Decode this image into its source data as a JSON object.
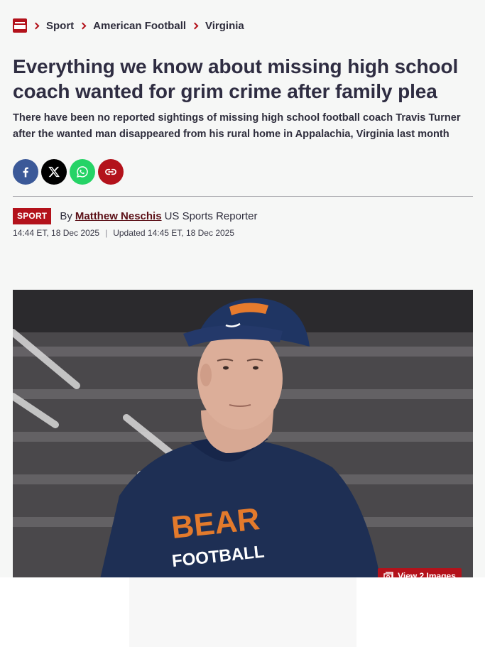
{
  "breadcrumb": {
    "logo_icon": "mirror-logo",
    "items": [
      "Sport",
      "American Football",
      "Virginia"
    ]
  },
  "article": {
    "headline": "Everything we know about missing high school coach wanted for grim crime after family plea",
    "standfirst": "There have been no reported sightings of missing high school football coach Travis Turner after the wanted man disappeared from his rural home in Appalachia, Virginia last month",
    "category_tag": "SPORT",
    "byline_prefix": "By",
    "author": "Matthew Neschis",
    "author_role": "US Sports Reporter",
    "published": "14:44 ET, 18 Dec 2025",
    "updated": "Updated 14:45 ET, 18 Dec 2025",
    "view_images_label": "View 2 Images"
  },
  "share": [
    {
      "name": "facebook-share-button",
      "icon": "facebook-icon",
      "color": "#3b5998"
    },
    {
      "name": "x-share-button",
      "icon": "x-icon",
      "color": "#000000"
    },
    {
      "name": "whatsapp-share-button",
      "icon": "whatsapp-icon",
      "color": "#25d366"
    },
    {
      "name": "copy-link-button",
      "icon": "link-icon",
      "color": "#b3121b"
    }
  ],
  "colors": {
    "brand_red": "#b3121b",
    "text_dark": "#2f2d42",
    "page_background": "#f6f7f6"
  }
}
